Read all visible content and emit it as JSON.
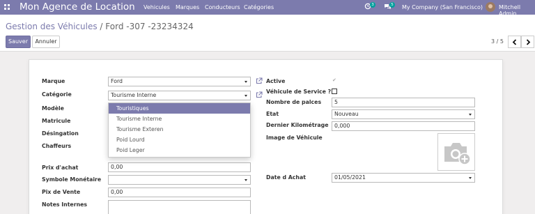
{
  "navbar": {
    "brand": "Mon Agence de Location",
    "menu": [
      "Vehicules",
      "Marques",
      "Conducteurs",
      "Catégories"
    ],
    "activity_count": "3",
    "message_count": "5",
    "company": "My Company (San Francisco)",
    "user": "Mitchell Admin"
  },
  "control_panel": {
    "breadcrumb_parent": "Gestion des Véhicules",
    "breadcrumb_separator": "/",
    "breadcrumb_current": "Ford -307 -23234324",
    "save_label": "Sauver",
    "discard_label": "Annuler",
    "pager_value": "3 / 5"
  },
  "form": {
    "labels": {
      "marque": "Marque",
      "categorie": "Catégorie",
      "modele": "Modèle",
      "matricule": "Matricule",
      "designation": "Désingation",
      "chaffeurs": "Chaffeurs",
      "prix_achat": "Prix d'achat",
      "symbole": "Symbole Monétaire",
      "prix_vente": "Pix de Vente",
      "notes": "Notes Internes",
      "active": "Active",
      "vehicule_service": "Véhicule de Service ?",
      "nombre_places": "Nombre de palces",
      "etat": "Etat",
      "dernier_km": "Dernier Kilométrage",
      "image": "Image de Véhicule",
      "date_achat": "Date d Achat"
    },
    "values": {
      "marque": "Ford",
      "categorie": "Tourisme Interne",
      "prix_achat": "0,00",
      "symbole": "",
      "prix_vente": "0,00",
      "nombre_places": "5",
      "etat": "Nouveau",
      "dernier_km": "0,000",
      "date_achat": "01/05/2021"
    },
    "active_checked": true,
    "vehicule_service_checked": false
  },
  "categorie_dropdown": {
    "options": [
      "Touristiques",
      "Tourisme Interne",
      "Tourisme Exteren",
      "Poid Lourd",
      "Poid Leger"
    ],
    "highlighted_index": 0
  },
  "colors": {
    "brand": "#7c7bad",
    "badge": "#00a09d"
  },
  "icons": {
    "apps": "apps-grid-icon",
    "activity": "clock-activity-icon",
    "messages": "chat-bubbles-icon",
    "external": "external-link-icon",
    "camera": "camera-plus-icon",
    "prev": "chevron-left-icon",
    "next": "chevron-right-icon"
  }
}
